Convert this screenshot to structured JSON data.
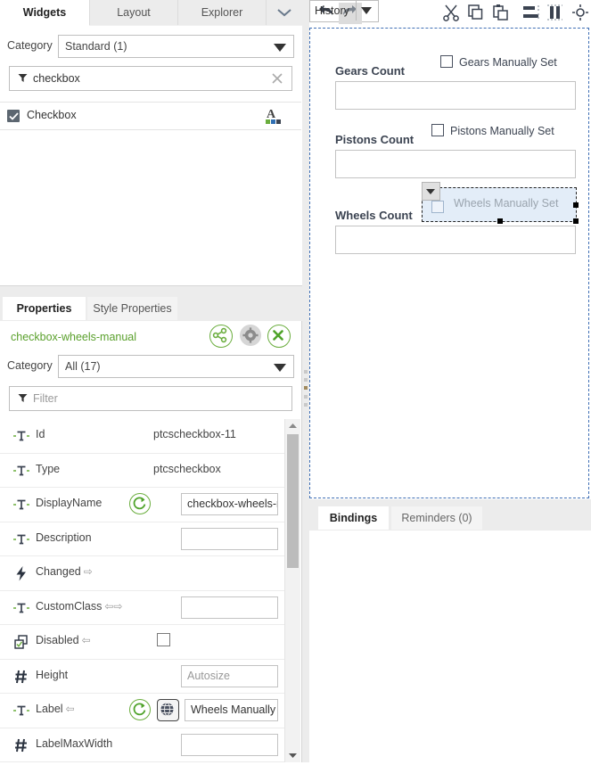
{
  "widgets_panel": {
    "tabs": [
      {
        "label": "Widgets",
        "active": true
      },
      {
        "label": "Layout",
        "active": false
      },
      {
        "label": "Explorer",
        "active": false
      }
    ],
    "chevron_icon": "chevron-down-icon",
    "category_label": "Category",
    "category_value": "Standard (1)",
    "filter_icon": "filter-icon",
    "filter_value": "checkbox",
    "clear_icon": "close-icon",
    "list": [
      {
        "label": "Checkbox",
        "icon": "checkbox-icon",
        "type_icon": "text-widget-icon"
      }
    ]
  },
  "properties_panel": {
    "tabs": [
      {
        "label": "Properties",
        "active": true
      },
      {
        "label": "Style Properties",
        "active": false
      }
    ],
    "widget_name": "checkbox-wheels-manual",
    "widget_name_color": "#5aa02c",
    "actions": [
      {
        "name": "share-icon"
      },
      {
        "name": "gear-icon"
      },
      {
        "name": "close-icon"
      }
    ],
    "category_label": "Category",
    "category_value": "All (17)",
    "filter_icon": "filter-icon",
    "filter_placeholder": "Filter",
    "rows": [
      {
        "icon": "text-type-icon",
        "label": "Id",
        "binding": "",
        "value": "ptcscheckbox-11",
        "kind": "text"
      },
      {
        "icon": "text-type-icon",
        "label": "Type",
        "binding": "",
        "value": "ptcscheckbox",
        "kind": "text"
      },
      {
        "icon": "text-type-icon",
        "label": "DisplayName",
        "binding": "",
        "value": "checkbox-wheels-man",
        "kind": "input-refresh"
      },
      {
        "icon": "text-type-icon",
        "label": "Description",
        "binding": "",
        "value": "",
        "kind": "input"
      },
      {
        "icon": "event-icon",
        "label": "Changed",
        "binding": "⇨",
        "value": "",
        "kind": "event"
      },
      {
        "icon": "text-type-icon",
        "label": "CustomClass",
        "binding": "⇦⇨",
        "value": "",
        "kind": "input"
      },
      {
        "icon": "boolean-icon",
        "label": "Disabled",
        "binding": "⇦",
        "value": "",
        "kind": "checkbox"
      },
      {
        "icon": "number-icon",
        "label": "Height",
        "binding": "",
        "value": "Autosize",
        "kind": "input-placeholder"
      },
      {
        "icon": "text-type-icon",
        "label": "Label",
        "binding": "⇦",
        "value": "Wheels Manually",
        "kind": "input-localized"
      },
      {
        "icon": "number-icon",
        "label": "LabelMaxWidth",
        "binding": "",
        "value": "",
        "kind": "input"
      }
    ],
    "scroll_up_icon": "scroll-up-icon",
    "scroll_down_icon": "scroll-down-icon"
  },
  "toolbar": {
    "undo_icon": "undo-icon",
    "redo_icon": "redo-icon",
    "history_label": "History",
    "history_caret_icon": "chevron-down-icon",
    "icons": [
      {
        "name": "cut-icon"
      },
      {
        "name": "copy-icon"
      },
      {
        "name": "paste-icon"
      },
      {
        "name": "align-horizontal-icon"
      },
      {
        "name": "align-vertical-icon"
      },
      {
        "name": "fit-to-container-icon"
      },
      {
        "name": "grid-icon"
      }
    ]
  },
  "canvas": {
    "fields": [
      {
        "label": "Gears Count",
        "checkbox_label": "Gears Manually Set",
        "checked": false,
        "value": ""
      },
      {
        "label": "Pistons Count",
        "checkbox_label": "Pistons Manually Set",
        "checked": false,
        "value": ""
      },
      {
        "label": "Wheels Count",
        "checkbox_label": "Wheels Manually Set",
        "checked": false,
        "value": "",
        "selected": true
      }
    ],
    "dropdown_icon": "chevron-down-icon"
  },
  "bindings_panel": {
    "tabs": [
      {
        "label": "Bindings",
        "active": true
      },
      {
        "label": "Reminders (0)",
        "active": false
      }
    ]
  },
  "colors": {
    "accent_green": "#7ab800",
    "selection_blue": "#3f6fb5",
    "selection_fill": "#e3edf8",
    "label_dark": "#3b4351"
  }
}
